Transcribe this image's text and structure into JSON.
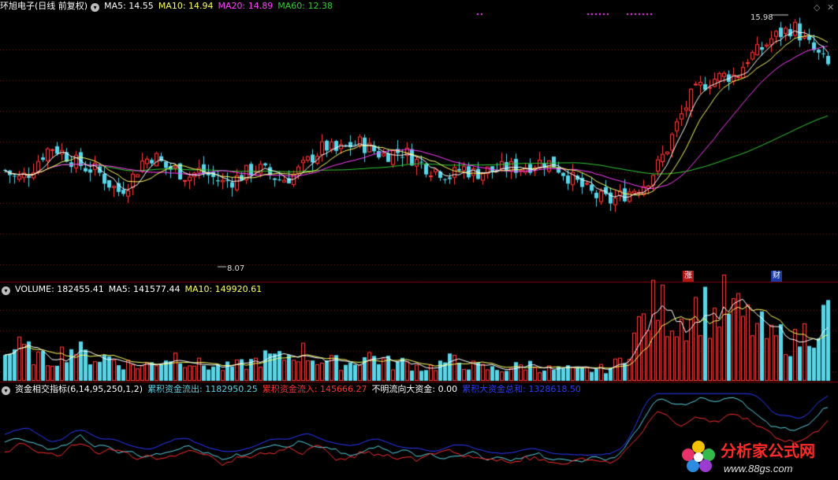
{
  "colors": {
    "background": "#000000",
    "up": "#ff4040",
    "down": "#5ad4e6",
    "ma5": "#ffffff",
    "ma10": "#ffff66",
    "ma20": "#ff40ff",
    "ma60": "#33cc33",
    "outflow": "#5ad4e6",
    "inflow": "#ff3030",
    "unknown": "#ffffff",
    "total": "#2b3bff",
    "separator": "#8b0000",
    "grid": "#7a1f1f"
  },
  "price_panel": {
    "title": "环旭电子(日线 前复权)",
    "ma5": "MA5: 14.55",
    "ma10": "MA10: 14.94",
    "ma20": "MA20: 14.89",
    "ma60": "MA60: 12.38",
    "high_label": "15.98",
    "low_label": "8.07",
    "badge_up": "涨",
    "badge_fin": "财"
  },
  "volume_panel": {
    "volume": "VOLUME: 182455.41",
    "ma5": "MA5: 141577.44",
    "ma10": "MA10: 149920.61"
  },
  "indicator_panel": {
    "name": "资金相交指标(6,14,95,250,1,2)",
    "outflow": "累积资金流出: 1182950.25",
    "inflow": "累积资金流入: 145666.27",
    "unknown": "不明流向大资金: 0.00",
    "total": "累积大资金总和: 1328618.50"
  },
  "watermark": {
    "text": "分析家公式网",
    "url": "www.88gs.com"
  },
  "chart_data": [
    {
      "type": "candlestick",
      "approx_close_path": [
        11.2,
        10.9,
        11.1,
        11.6,
        12.0,
        11.8,
        11.5,
        11.3,
        11.2,
        10.8,
        10.5,
        10.9,
        11.5,
        11.7,
        11.3,
        11.2,
        11.0,
        11.2,
        11.0,
        10.8,
        10.9,
        11.1,
        11.3,
        11.1,
        10.9,
        11.0,
        11.3,
        11.7,
        12.0,
        11.8,
        12.0,
        12.1,
        11.9,
        11.7,
        11.8,
        11.8,
        11.5,
        11.3,
        11.2,
        11.0,
        11.3,
        11.1,
        11.2,
        11.2,
        11.3,
        11.3,
        11.4,
        11.5,
        11.4,
        11.1,
        10.8,
        10.5,
        10.3,
        10.2,
        10.4,
        10.6,
        10.8,
        11.3,
        12.0,
        12.9,
        13.6,
        14.0,
        14.2,
        14.3,
        14.3,
        14.9,
        15.1,
        15.5,
        15.7,
        15.9,
        15.4,
        15.0,
        14.6
      ],
      "high": 15.98,
      "low": 8.07
    },
    {
      "type": "bar",
      "name": "VOLUME",
      "approx_values": [
        70000,
        90000,
        80000,
        60000,
        55000,
        75000,
        90000,
        70000,
        60000,
        65000,
        50000,
        45000,
        40000,
        50000,
        60000,
        70000,
        55000,
        45000,
        40000,
        35000,
        40000,
        45000,
        55000,
        65000,
        60000,
        70000,
        80000,
        60000,
        55000,
        50000,
        45000,
        60000,
        70000,
        55000,
        45000,
        50000,
        40000,
        35000,
        45000,
        55000,
        50000,
        40000,
        35000,
        30000,
        35000,
        40000,
        45000,
        35000,
        30000,
        32000,
        28000,
        30000,
        32000,
        35000,
        60000,
        120000,
        170000,
        210000,
        180000,
        160000,
        190000,
        200000,
        170000,
        210000,
        180000,
        160000,
        140000,
        110000,
        120000,
        100000,
        130000,
        150000,
        180000
      ]
    },
    {
      "type": "line",
      "name": "资金相交指标",
      "series_colors": {
        "outflow": "#5ad4e6",
        "inflow": "#ff3030",
        "total": "#2b3bff"
      }
    }
  ]
}
